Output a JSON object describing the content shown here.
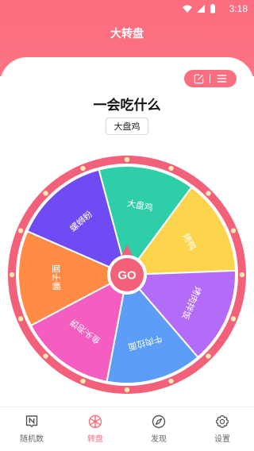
{
  "status_bar": {
    "time": "3:18"
  },
  "header": {
    "title": "大转盘"
  },
  "question": {
    "title": "一会吃什么"
  },
  "result": {
    "text": "大盘鸡"
  },
  "wheel": {
    "center_label": "GO",
    "segments": [
      {
        "label": "大盘鸡",
        "color": "#2dcea8"
      },
      {
        "label": "烤鸭",
        "color": "#fcd54d"
      },
      {
        "label": "烤肉拌饭",
        "color": "#b36cf8"
      },
      {
        "label": "牛肉拉面",
        "color": "#5b9df7"
      },
      {
        "label": "鱼头泡饼",
        "color": "#f45ec0"
      },
      {
        "label": "臊子面",
        "color": "#ff8b45"
      },
      {
        "label": "螺蛳粉",
        "color": "#6f4bf3"
      }
    ]
  },
  "tabs": [
    {
      "label": "随机数",
      "icon": "n-box-icon",
      "active": false
    },
    {
      "label": "转盘",
      "icon": "wheel-icon",
      "active": true
    },
    {
      "label": "发现",
      "icon": "compass-icon",
      "active": false
    },
    {
      "label": "设置",
      "icon": "gear-icon",
      "active": false
    }
  ],
  "colors": {
    "accent": "#fb6e7f"
  }
}
